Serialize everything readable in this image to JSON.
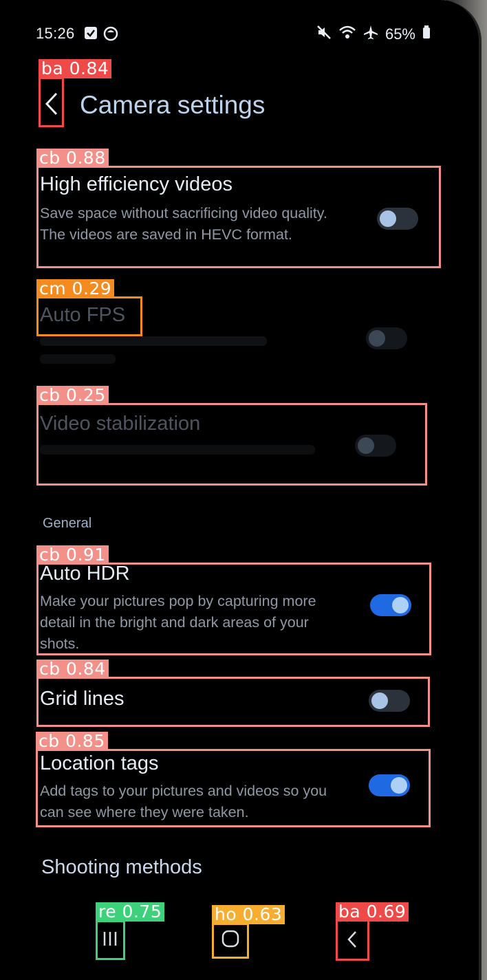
{
  "status_bar": {
    "time": "15:26",
    "battery": "65%"
  },
  "header": {
    "title": "Camera settings"
  },
  "settings": [
    {
      "title": "High efficiency videos",
      "desc": "Save space without sacrificing video quality. The videos are saved in HEVC format.",
      "state": "off"
    },
    {
      "title": "Auto FPS",
      "desc": "",
      "state": "disabled"
    },
    {
      "title": "Video stabilization",
      "desc": "",
      "state": "disabled"
    }
  ],
  "general": {
    "header": "General",
    "items": [
      {
        "title": "Auto HDR",
        "desc": "Make your pictures pop by capturing more detail in the bright and dark areas of your shots.",
        "state": "on"
      },
      {
        "title": "Grid lines",
        "desc": "",
        "state": "off"
      },
      {
        "title": "Location tags",
        "desc": "Add tags to your pictures and videos so you can see where they were taken.",
        "state": "on"
      }
    ]
  },
  "shooting_methods": "Shooting methods",
  "detections": [
    {
      "label": "ba 0.84",
      "color": "#f04a48"
    },
    {
      "label": "cb 0.88",
      "color": "#f4908a"
    },
    {
      "label": "cm 0.29",
      "color": "#f58a1f"
    },
    {
      "label": "cb 0.25",
      "color": "#f4908a"
    },
    {
      "label": "cb 0.91",
      "color": "#f4908a"
    },
    {
      "label": "cb 0.84",
      "color": "#f4908a"
    },
    {
      "label": "cb 0.85",
      "color": "#f4908a"
    },
    {
      "label": "re 0.75",
      "color": "#3dd17b"
    },
    {
      "label": "ho 0.63",
      "color": "#f7ad2f"
    },
    {
      "label": "ba 0.69",
      "color": "#f04a48"
    }
  ]
}
